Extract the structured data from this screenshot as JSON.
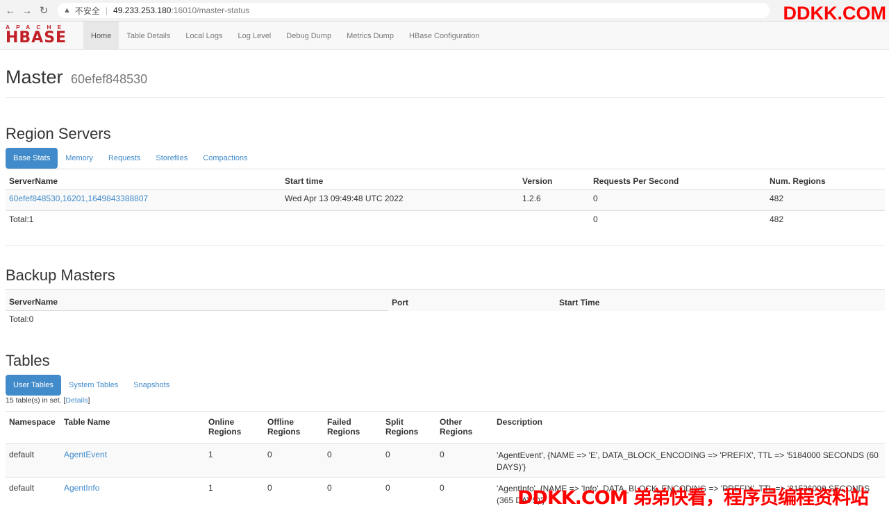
{
  "browser": {
    "back_icon": "←",
    "forward_icon": "→",
    "reload_icon": "↻",
    "warning_icon": "▲",
    "insecure_label": "不安全",
    "host": "49.233.253.180",
    "path": ":16010/master-status"
  },
  "watermark_top": "DDKK.COM",
  "watermark_bottom": "DDKK.COM 弟弟快看，程序员编程资料站",
  "logo": {
    "line1": "APACHE",
    "line2": "HBASE"
  },
  "nav": [
    "Home",
    "Table Details",
    "Local Logs",
    "Log Level",
    "Debug Dump",
    "Metrics Dump",
    "HBase Configuration"
  ],
  "master": {
    "title": "Master",
    "host": "60efef848530"
  },
  "region_servers": {
    "heading": "Region Servers",
    "tabs": [
      "Base Stats",
      "Memory",
      "Requests",
      "Storefiles",
      "Compactions"
    ],
    "columns": [
      "ServerName",
      "Start time",
      "Version",
      "Requests Per Second",
      "Num. Regions"
    ],
    "rows": [
      {
        "server": "60efef848530,16201,1649843388807",
        "start": "Wed Apr 13 09:49:48 UTC 2022",
        "version": "1.2.6",
        "rps": "0",
        "regions": "482"
      }
    ],
    "total": {
      "label": "Total:1",
      "rps": "0",
      "regions": "482"
    }
  },
  "backup_masters": {
    "heading": "Backup Masters",
    "columns": [
      "ServerName",
      "Port",
      "Start Time"
    ],
    "total": "Total:0"
  },
  "tables": {
    "heading": "Tables",
    "tabs": [
      "User Tables",
      "System Tables",
      "Snapshots"
    ],
    "count_text": "15 table(s) in set. [",
    "details_link": "Details",
    "count_suffix": "]",
    "columns": [
      "Namespace",
      "Table Name",
      "Online Regions",
      "Offline Regions",
      "Failed Regions",
      "Split Regions",
      "Other Regions",
      "Description"
    ],
    "rows": [
      {
        "ns": "default",
        "name": "AgentEvent",
        "online": "1",
        "offline": "0",
        "failed": "0",
        "split": "0",
        "other": "0",
        "desc": "'AgentEvent', {NAME => 'E', DATA_BLOCK_ENCODING => 'PREFIX', TTL => '5184000 SECONDS (60 DAYS)'}"
      },
      {
        "ns": "default",
        "name": "AgentInfo",
        "online": "1",
        "offline": "0",
        "failed": "0",
        "split": "0",
        "other": "0",
        "desc": "'AgentInfo', {NAME => 'Info', DATA_BLOCK_ENCODING => 'PREFIX', TTL => '31536000 SECONDS (365 DAYS)'}"
      }
    ]
  }
}
